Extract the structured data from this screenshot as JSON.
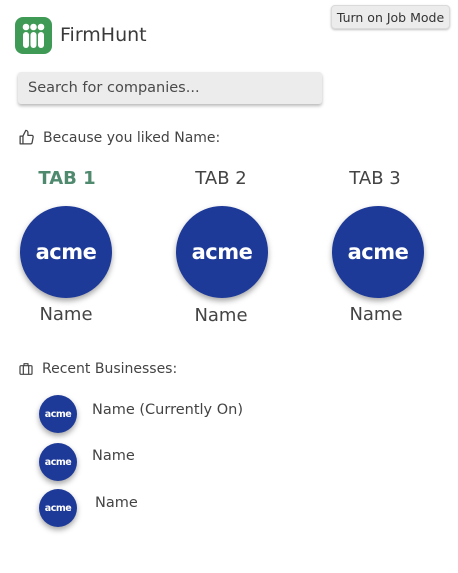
{
  "header": {
    "mode_button_label": "Turn on Job Mode",
    "app_name": "FirmHunt",
    "brand_color": "#3f9a55"
  },
  "search": {
    "placeholder": "Search for companies..."
  },
  "recommendations": {
    "heading": "Because you liked Name:",
    "icon": "thumbs-up-icon",
    "active_tab_color": "#4f8a6e",
    "tabs": [
      {
        "label": "TAB 1",
        "active": true,
        "logo_text": "acme",
        "name": "Name"
      },
      {
        "label": "TAB 2",
        "active": false,
        "logo_text": "acme",
        "name": "Name"
      },
      {
        "label": "TAB 3",
        "active": false,
        "logo_text": "acme",
        "name": "Name"
      }
    ]
  },
  "recent": {
    "heading": "Recent Businesses:",
    "icon": "briefcase-icon",
    "items": [
      {
        "logo_text": "acme",
        "name": "Name (Currently On)"
      },
      {
        "logo_text": "acme",
        "name": "Name"
      },
      {
        "logo_text": "acme",
        "name": "Name"
      }
    ]
  },
  "logo_color": "#1e3a98"
}
